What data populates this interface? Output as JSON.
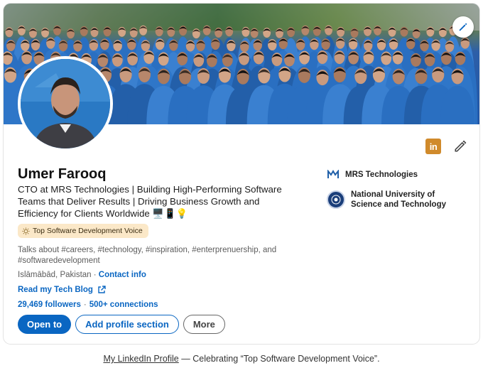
{
  "profile": {
    "name": "Umer Farooq",
    "headline": "CTO at MRS Technologies | Building High-Performing Software Teams that Deliver Results | Driving Business Growth and Efficiency for Clients Worldwide 🖥️📱💡",
    "badge": "Top Software Development Voice",
    "talks_about": "Talks about #careers, #technology, #inspiration, #enterprenuership, and #softwaredevelopment",
    "location": "Islāmābād, Pakistan",
    "location_sep": " · ",
    "contact_info": "Contact info",
    "website_label": "Read my Tech Blog",
    "followers": "29,469 followers",
    "connections": "500+ connections",
    "stats_sep": "·"
  },
  "actions": {
    "open_to": "Open to",
    "add_section": "Add profile section",
    "more": "More"
  },
  "experience": {
    "company": "MRS Technologies",
    "education": "National University of Science and Technology"
  },
  "caption": {
    "link_text": "My LinkedIn Profile",
    "rest": " — Celebrating “Top Software Development Voice”."
  },
  "icons": {
    "linkedin": "in",
    "edit": "pencil-icon",
    "cover_edit": "pencil-icon",
    "external": "external-link-icon",
    "badge": "sun-icon"
  },
  "colors": {
    "brand_blue": "#0a66c2",
    "badge_bg": "#fbe8c8",
    "linkedin_icon": "#d08a2b"
  }
}
